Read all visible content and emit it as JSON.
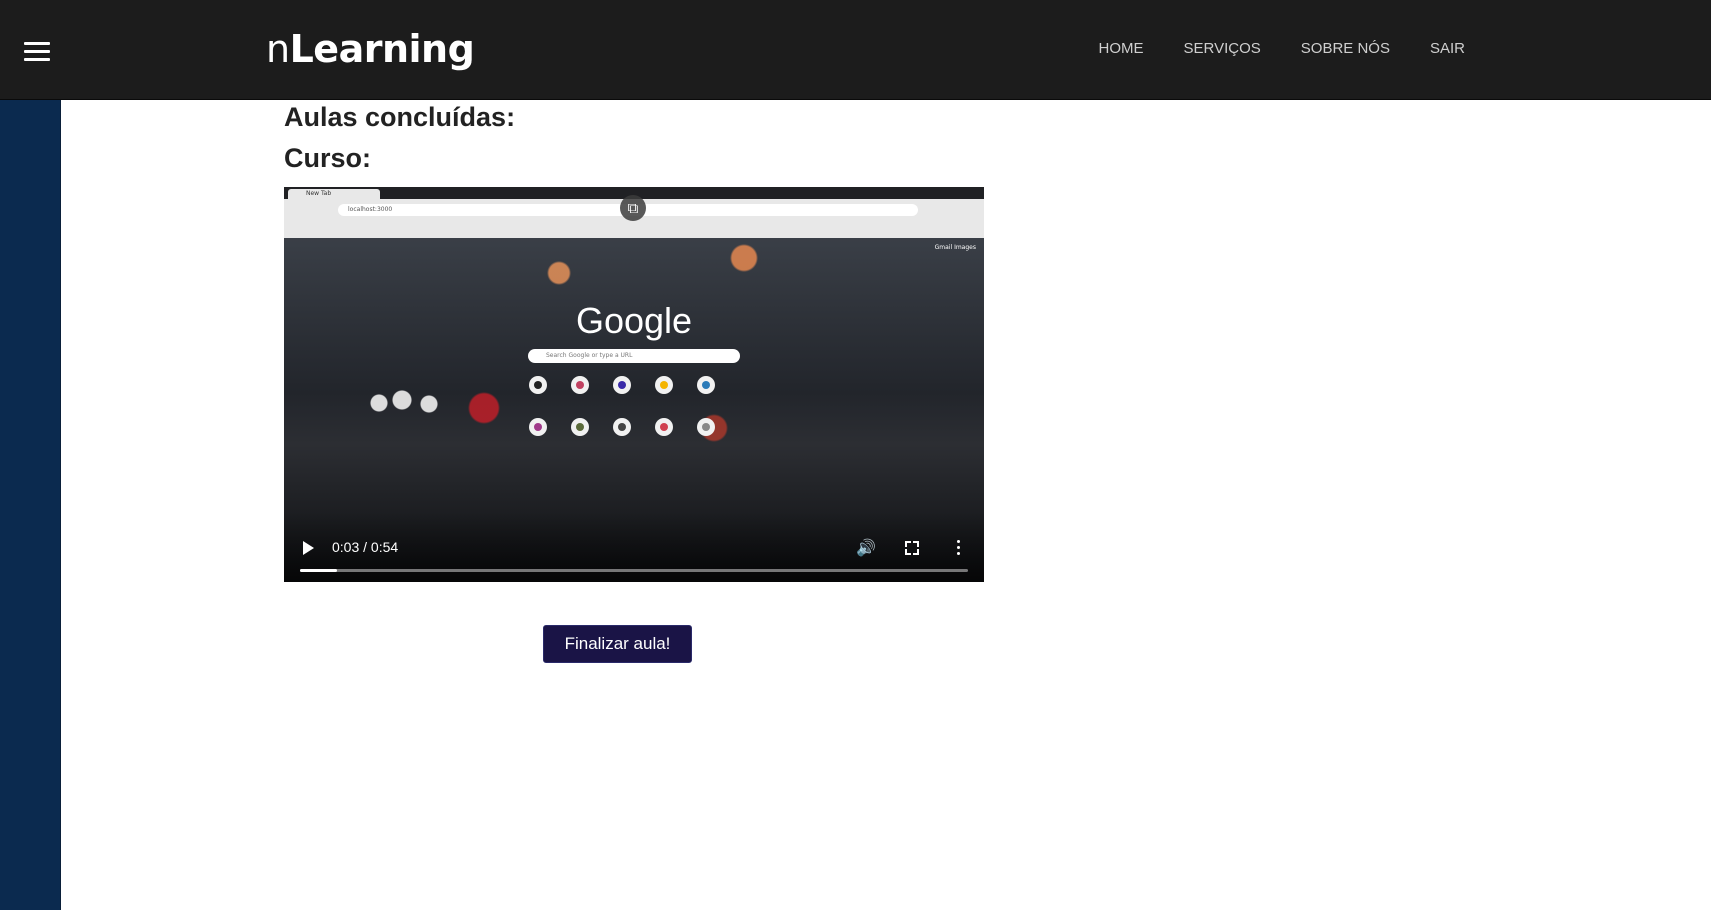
{
  "header": {
    "menu_icon": "hamburger-icon",
    "brand_light": "n",
    "brand_bold": "Learning",
    "nav": [
      {
        "label": "HOME"
      },
      {
        "label": "SERVIÇOS"
      },
      {
        "label": "SOBRE NÓS"
      },
      {
        "label": "SAIR"
      }
    ]
  },
  "main": {
    "completed_label": "Aulas concluídas:",
    "course_label": "Curso:",
    "finish_button": "Finalizar aula!"
  },
  "video": {
    "time": "0:03 / 0:54",
    "progress": 0.056,
    "frame": {
      "tab_title": "New Tab",
      "address": "localhost:3000",
      "google": "Google",
      "search_placeholder": "Search Google or type a URL",
      "top_links": "Gmail  Images"
    }
  },
  "colors": {
    "header_bg": "#1c1c1c",
    "sidebar_bg": "#0b2a4f",
    "button_bg": "#1a1446"
  }
}
